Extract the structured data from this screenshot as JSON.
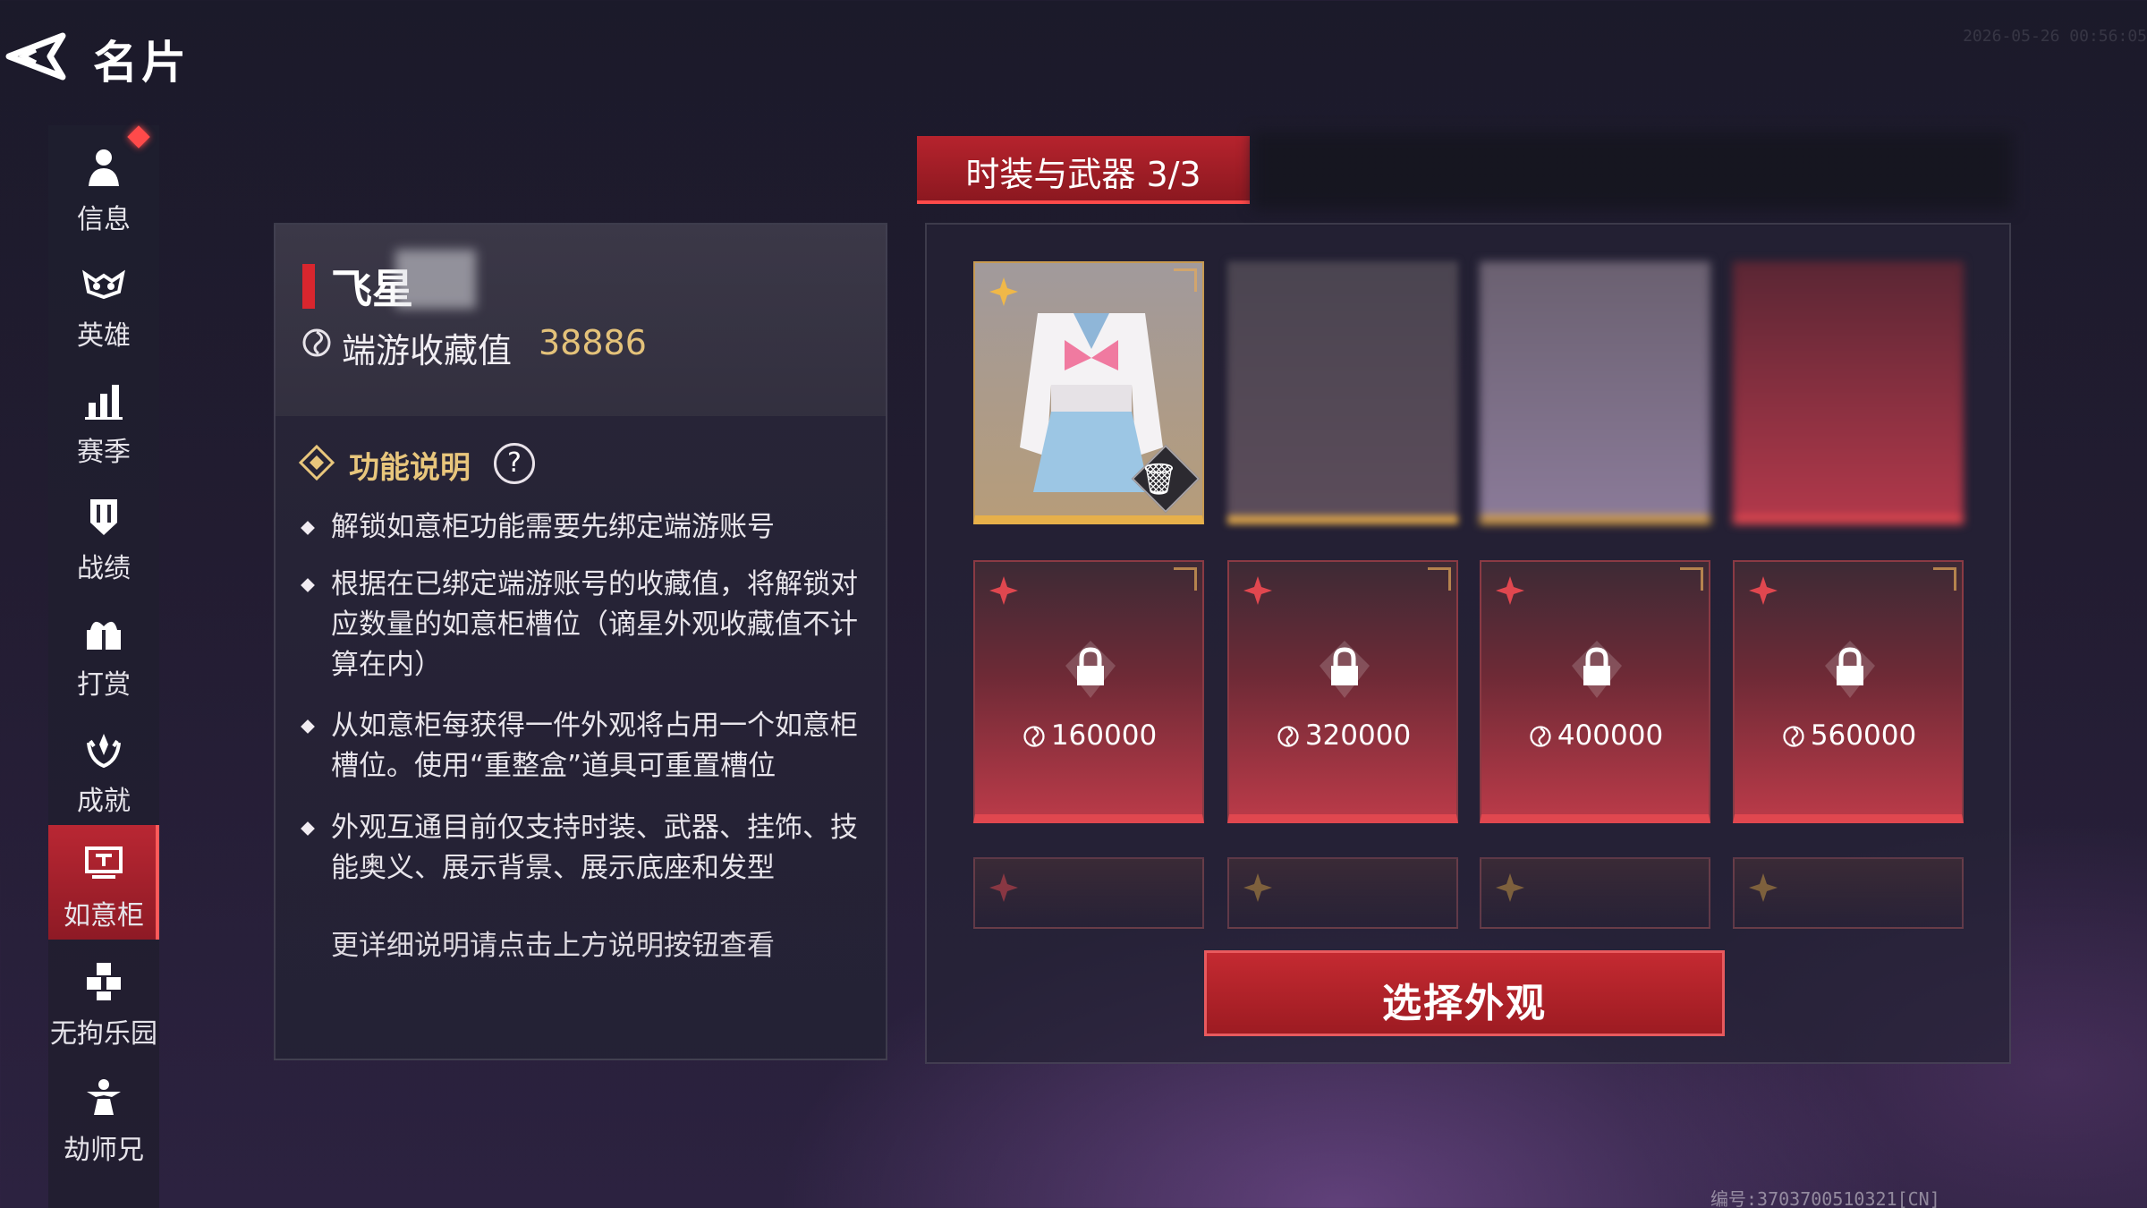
{
  "header": {
    "title": "名片",
    "back_icon": "back-arrow-icon",
    "timestamp": "2026-05-26 00:56:05"
  },
  "sidebar": {
    "items": [
      {
        "label": "信息",
        "icon": "person-icon",
        "badge": true
      },
      {
        "label": "英雄",
        "icon": "mask-icon"
      },
      {
        "label": "赛季",
        "icon": "bar-chart-icon"
      },
      {
        "label": "战绩",
        "icon": "shield-icon"
      },
      {
        "label": "打赏",
        "icon": "gift-icon"
      },
      {
        "label": "成就",
        "icon": "laurel-icon"
      },
      {
        "label": "如意柜",
        "icon": "cabinet-icon",
        "active": true
      },
      {
        "label": "无拘乐园",
        "icon": "cubes-icon"
      },
      {
        "label": "劫师兄",
        "icon": "figure-icon"
      }
    ]
  },
  "profile": {
    "name": "飞星",
    "collection_label": "端游收藏值",
    "collection_value": "38886"
  },
  "function_info": {
    "title": "功能说明",
    "help_label": "?",
    "rules": [
      "解锁如意柜功能需要先绑定端游账号",
      "根据在已绑定端游账号的收藏值，将解锁对应数量的如意柜槽位（谪星外观收藏值不计算在内）",
      "从如意柜每获得一件外观将占用一个如意柜槽位。使用“重整盒”道具可重置槽位",
      "外观互通目前仅支持时装、武器、挂饰、技能奥义、展示背景、展示底座和发型"
    ],
    "note": "更详细说明请点击上方说明按钮查看"
  },
  "tabs": {
    "active_label": "时装与武器 3/3"
  },
  "slots": {
    "locked_prices": [
      "160000",
      "320000",
      "400000",
      "560000"
    ]
  },
  "actions": {
    "select_label": "选择外观"
  },
  "footer": {
    "serial": "编号:3703700510321[CN]"
  },
  "colors": {
    "accent_red": "#c42a31",
    "gold": "#e7b04a",
    "value_gold": "#e4c27a"
  }
}
